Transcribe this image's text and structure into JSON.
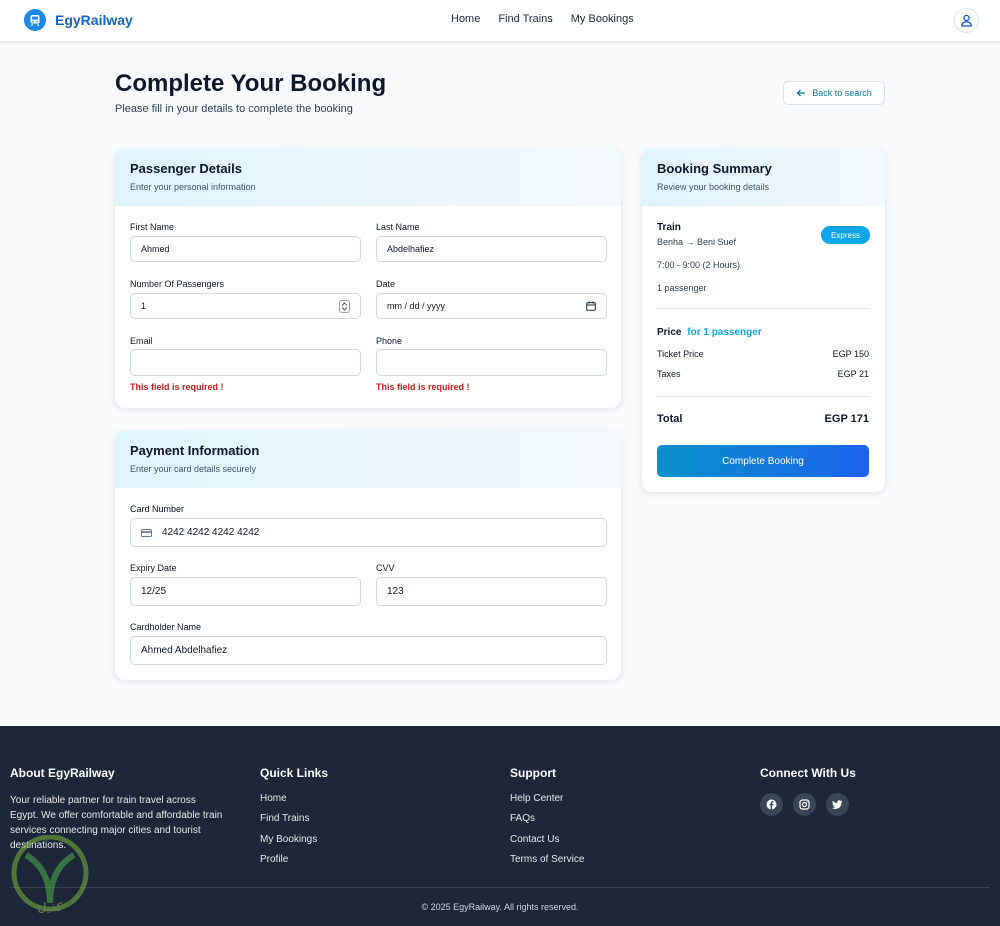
{
  "nav": {
    "brand": "EgyRailway",
    "links": [
      "Home",
      "Find Trains",
      "My Bookings"
    ]
  },
  "header": {
    "title": "Complete Your Booking",
    "subtitle": "Please fill in your details to complete the booking",
    "back_label": "Back to search"
  },
  "passenger": {
    "title": "Passenger Details",
    "subtitle": "Enter your personal information",
    "first_name_label": "First Name",
    "first_name_value": "Ahmed",
    "last_name_label": "Last Name",
    "last_name_value": "Abdelhafiez",
    "passengers_label": "Number Of Passengers",
    "passengers_value": "1",
    "date_label": "Date",
    "date_placeholder": "mm / dd / yyyy",
    "email_label": "Email",
    "email_value": "",
    "phone_label": "Phone",
    "phone_value": "",
    "error_text": "This field is required !"
  },
  "payment": {
    "title": "Payment Information",
    "subtitle": "Enter your card details securely",
    "card_label": "Card Number",
    "card_value": "4242 4242 4242 4242",
    "expiry_label": "Expiry Date",
    "expiry_value": "12/25",
    "cvv_label": "CVV",
    "cvv_value": "123",
    "holder_label": "Cardholder Name",
    "holder_value": "Ahmed Abdelhafiez"
  },
  "summary": {
    "title": "Booking Summary",
    "subtitle": "Review your booking details",
    "train_label": "Train",
    "route": "Benha → Beni Suef",
    "badge": "Express",
    "time": "7:00 - 9:00 (2 Hours)",
    "passengers": "1 passenger",
    "price_label": "Price",
    "price_for": "for 1 passenger",
    "ticket_label": "Ticket Price",
    "ticket_value": "EGP 150",
    "taxes_label": "Taxes",
    "taxes_value": "EGP 21",
    "total_label": "Total",
    "total_value": "EGP 171",
    "cta": "Complete Booking"
  },
  "footer": {
    "about_title": "About EgyRailway",
    "about_text": "Your reliable partner for train travel across Egypt. We offer comfortable and affordable train services connecting major cities and tourist destinations.",
    "quick_title": "Quick Links",
    "quick_links": [
      "Home",
      "Find Trains",
      "My Bookings",
      "Profile"
    ],
    "support_title": "Support",
    "support_links": [
      "Help Center",
      "FAQs",
      "Contact Us",
      "Terms of Service"
    ],
    "connect_title": "Connect With Us",
    "copyright": "© 2025 EgyRailway. All rights reserved.",
    "watermark_text": "كفيل"
  },
  "colors": {
    "brand": "#1565c0",
    "accent": "#0ea5e9",
    "error": "#c81e1e",
    "footer_bg": "#1e2737"
  }
}
